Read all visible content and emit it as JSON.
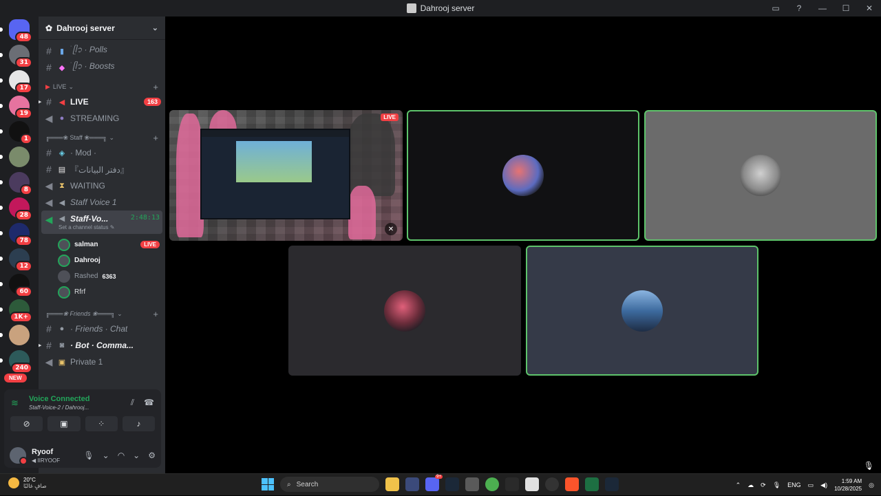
{
  "window": {
    "title": "Dahrooj server"
  },
  "guilds": [
    {
      "badge": "48",
      "color": "#5865f2"
    },
    {
      "badge": "31",
      "color": "#6b6e75"
    },
    {
      "badge": "17",
      "color": "#e6e6e6"
    },
    {
      "badge": "19",
      "color": "#e6739f"
    },
    {
      "badge": "1",
      "color": "#111111"
    },
    {
      "badge": "",
      "color": "#7a8b6b"
    },
    {
      "badge": "8",
      "color": "#4b3b5e"
    },
    {
      "badge": "28",
      "color": "#c2185b"
    },
    {
      "badge": "78",
      "color": "#1e2a6b"
    },
    {
      "badge": "12",
      "color": "#2c3e50"
    },
    {
      "badge": "60",
      "color": "#111111"
    },
    {
      "badge": "1K+",
      "color": "#2d5a3a"
    },
    {
      "badge": "",
      "color": "#c9a27e"
    },
    {
      "badge": "240",
      "color": "#2d5a5a"
    }
  ],
  "new_label": "NEW",
  "server": {
    "name": "Dahrooj server"
  },
  "channels": {
    "polls": "ׂ ᥫ᭡ · Polls",
    "boosts": "ׂ ᥫ᭡ · Boosts",
    "cat_live": "LIVE",
    "live": "LIVE",
    "live_badge": "163",
    "streaming": "STREAMING",
    "cat_staff": "╔═══❀ Staff ❀═══╗",
    "mod": "· Mod ·",
    "data": "『دفتر البيانات』",
    "waiting": "WAITING",
    "staff1": "Staff Voice 1",
    "staff2": "Staff-Vo...",
    "timer": "2:48:13",
    "status": "Set a channel status",
    "cat_friends": "╔═══❀ Friends ❀═══╗",
    "friends": "· Friends · Chat",
    "bot": "· Bot · Comma...",
    "private": "Private 1"
  },
  "voice_users": [
    {
      "name": "salman",
      "tag": "",
      "live": "LIVE"
    },
    {
      "name": "Dahrooj",
      "tag": "",
      "live": ""
    },
    {
      "name": "Rashed",
      "tag": "6363",
      "live": ""
    },
    {
      "name": "Rfrf",
      "tag": "",
      "live": ""
    }
  ],
  "voice_panel": {
    "status": "Voice Connected",
    "channel": "Staff-Voice-2 / Dahrooj..."
  },
  "user": {
    "name": "Ryoof",
    "status": "IIRYOOF"
  },
  "stream": {
    "live_label": "LIVE"
  },
  "taskbar": {
    "temp": "20°C",
    "weather": "صافٍ غالبًا",
    "search": "Search",
    "lang": "ENG",
    "time": "1:59 AM",
    "date": "10/28/2025"
  }
}
